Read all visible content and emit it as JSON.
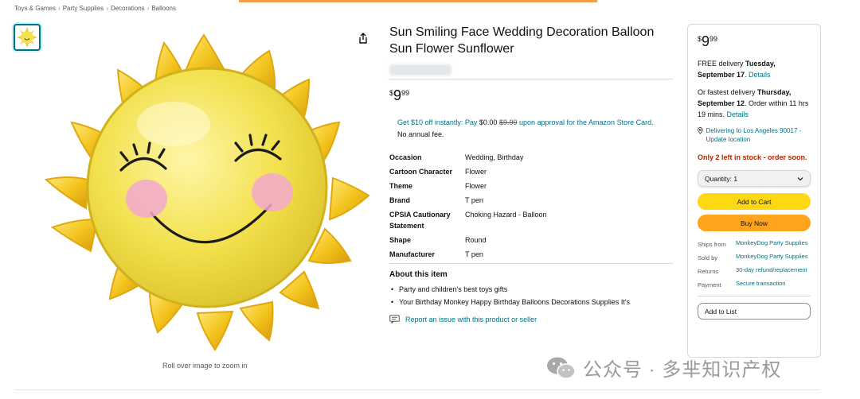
{
  "breadcrumb": [
    "Toys & Games",
    "Party Supplies",
    "Decorations",
    "Balloons"
  ],
  "image": {
    "zoom_hint": "Roll over image to zoom in",
    "icon": "sun-balloon"
  },
  "product": {
    "title": "Sun Smiling Face Wedding Decoration Balloon Sun Flower Sunflower",
    "price": {
      "symbol": "$",
      "whole": "9",
      "fraction": "99"
    },
    "promo": {
      "line1_link": "Get $10 off instantly: Pay ",
      "line1_now": "$0.00",
      "line1_was": "$9.99",
      "line1_tail": " upon approval for the Amazon Store Card.",
      "line2": "No annual fee."
    },
    "specs": [
      {
        "key": "Occasion",
        "value": "Wedding, Birthday"
      },
      {
        "key": "Cartoon Character",
        "value": "Flower"
      },
      {
        "key": "Theme",
        "value": "Flower"
      },
      {
        "key": "Brand",
        "value": "T pen"
      },
      {
        "key": "CPSIA Cautionary Statement",
        "value": "Choking Hazard - Balloon"
      },
      {
        "key": "Shape",
        "value": "Round"
      },
      {
        "key": "Manufacturer",
        "value": "T pen"
      }
    ],
    "about_heading": "About this item",
    "bullets": [
      "Party and children's best toys gifts",
      "Your Birthday Monkey Happy Birthday Balloons Decorations Supplies It's"
    ],
    "report_link": "Report an issue with this product or seller"
  },
  "buybox": {
    "price": {
      "symbol": "$",
      "whole": "9",
      "fraction": "99"
    },
    "delivery_prefix": "FREE delivery ",
    "delivery_date": "Tuesday, September 17",
    "delivery_suffix": ". ",
    "details_label": "Details",
    "fastest_prefix": "Or fastest delivery ",
    "fastest_date": "Thursday, September 12",
    "fastest_suffix": ". Order within 11 hrs 19 mins. ",
    "location": "Delivering to Los Angeles 90017 - Update location",
    "stock": "Only 2 left in stock - order soon.",
    "quantity_label": "Quantity: 1",
    "add_to_cart": "Add to Cart",
    "buy_now": "Buy Now",
    "meta": [
      {
        "key": "Ships from",
        "value": "MonkeyDog Party Supplies"
      },
      {
        "key": "Sold by",
        "value": "MonkeyDog Party Supplies"
      },
      {
        "key": "Returns",
        "value": "30-day refund/replacement"
      },
      {
        "key": "Payment",
        "value": "Secure transaction"
      }
    ],
    "add_to_list": "Add to List"
  },
  "watermark": {
    "text": "公众号 · 多芈知识产权"
  },
  "colors": {
    "link": "#007185",
    "price_stock_red": "#B12704",
    "cart_yellow": "#FFD814",
    "buy_orange": "#FFA41C",
    "sun_yellow": "#F5E04A"
  }
}
